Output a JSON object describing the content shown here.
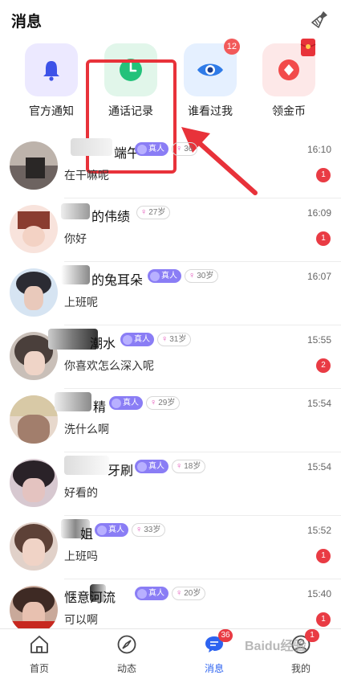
{
  "header": {
    "title": "消息"
  },
  "quick_actions": [
    {
      "label": "官方通知",
      "icon": "bell-icon",
      "bg": "#ece9ff",
      "badge": ""
    },
    {
      "label": "通话记录",
      "icon": "clock-icon",
      "bg": "#e1f6ea",
      "badge": ""
    },
    {
      "label": "谁看过我",
      "icon": "eye-icon",
      "bg": "#e5f0ff",
      "badge": "12"
    },
    {
      "label": "领金币",
      "icon": "red-envelope-icon",
      "bg": "#fde8e8",
      "badge": ""
    }
  ],
  "messages": [
    {
      "name": "端午",
      "real": "真人",
      "age": "36",
      "time": "16:10",
      "text": "在干嘛呢",
      "unread": "1"
    },
    {
      "name": "的伟绩",
      "real": "",
      "age": "27岁",
      "time": "16:09",
      "text": "你好",
      "unread": "1"
    },
    {
      "name": "的兔耳朵",
      "real": "真人",
      "age": "30岁",
      "time": "16:07",
      "text": "上班呢",
      "unread": ""
    },
    {
      "name": "潮水",
      "real": "真人",
      "age": "31岁",
      "time": "15:55",
      "text": "你喜欢怎么深入呢",
      "unread": "2"
    },
    {
      "name": "精",
      "real": "真人",
      "age": "29岁",
      "time": "15:54",
      "text": "洗什么啊",
      "unread": ""
    },
    {
      "name": "牙刷",
      "real": "真人",
      "age": "18岁",
      "time": "15:54",
      "text": "好看的",
      "unread": ""
    },
    {
      "name": "姐",
      "real": "真人",
      "age": "33岁",
      "time": "15:52",
      "text": "上班吗",
      "unread": "1"
    },
    {
      "name": "惬意河流",
      "real": "真人",
      "age": "20岁",
      "time": "15:40",
      "text": "可以啊",
      "unread": "1"
    }
  ],
  "tabbar": [
    {
      "label": "首页",
      "icon": "home-icon",
      "badge": ""
    },
    {
      "label": "动态",
      "icon": "compass-icon",
      "badge": ""
    },
    {
      "label": "消息",
      "icon": "chat-icon",
      "badge": "36"
    },
    {
      "label": "我的",
      "icon": "profile-icon",
      "badge": "1"
    }
  ],
  "watermark": "Baidu经验",
  "colors": {
    "accent": "#2d63f0",
    "annotation": "#e8323a",
    "badge": "#e93b44",
    "real_tag": "#8a7df5"
  }
}
